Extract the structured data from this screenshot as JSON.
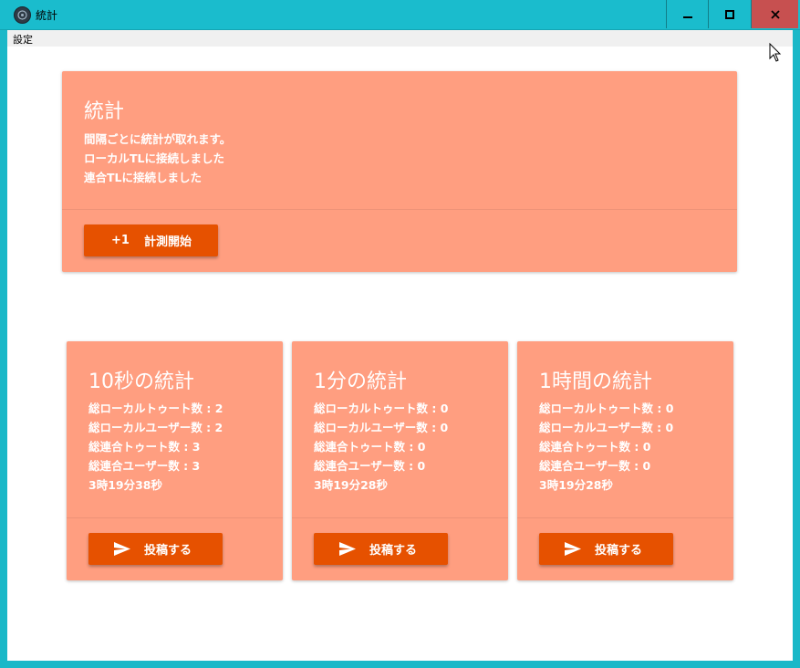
{
  "window": {
    "title": "統計",
    "minimize_icon": "minimize-icon",
    "maximize_icon": "maximize-icon",
    "close_icon": "close-icon"
  },
  "menu": {
    "settings": "設定"
  },
  "main_card": {
    "title": "統計",
    "lines": [
      "間隔ごとに統計が取れます。",
      "ローカルTLに接続しました",
      "連合TLに接続しました"
    ],
    "button_prefix": "+1",
    "button_label": "計測開始"
  },
  "stat_cards": [
    {
      "title": "10秒の統計",
      "lines": [
        "総ローカルトゥート数 : 2",
        "総ローカルユーザー数 : 2",
        "総連合トゥート数 : 3",
        "総連合ユーザー数 : 3",
        "3時19分38秒"
      ],
      "button_label": "投稿する"
    },
    {
      "title": "1分の統計",
      "lines": [
        "総ローカルトゥート数 : 0",
        "総ローカルユーザー数 : 0",
        "総連合トゥート数 : 0",
        "総連合ユーザー数 : 0",
        "3時19分28秒"
      ],
      "button_label": "投稿する"
    },
    {
      "title": "1時間の統計",
      "lines": [
        "総ローカルトゥート数 : 0",
        "総ローカルユーザー数 : 0",
        "総連合トゥート数 : 0",
        "総連合ユーザー数 : 0",
        "3時19分28秒"
      ],
      "button_label": "投稿する"
    }
  ],
  "colors": {
    "card": "#ff9e80",
    "button": "#e65100",
    "titlebar": "#1abccd",
    "close": "#c75050"
  }
}
